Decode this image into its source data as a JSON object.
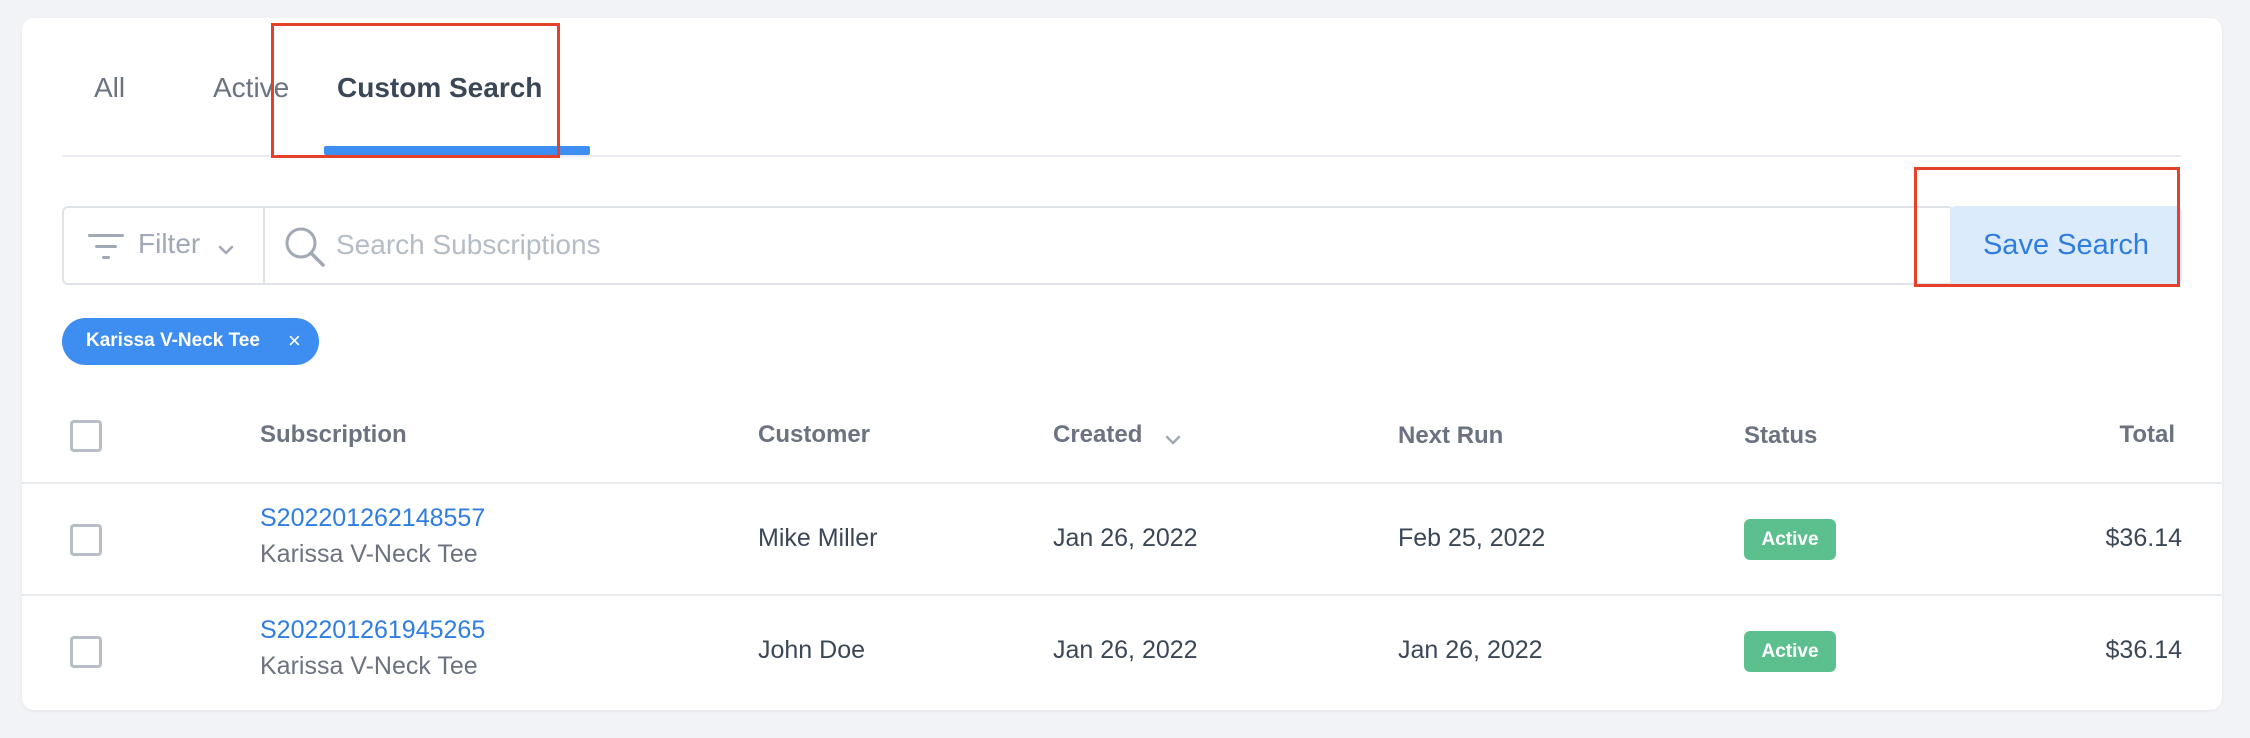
{
  "tabs": [
    {
      "label": "All"
    },
    {
      "label": "Active"
    },
    {
      "label": "Custom Search"
    }
  ],
  "toolbar": {
    "filter_label": "Filter",
    "search_placeholder": "Search Subscriptions",
    "save_label": "Save Search"
  },
  "chip": {
    "label": "Karissa V-Neck Tee",
    "close": "×"
  },
  "table": {
    "headers": {
      "subscription": "Subscription",
      "customer": "Customer",
      "created": "Created",
      "next_run": "Next Run",
      "status": "Status",
      "total": "Total"
    },
    "rows": [
      {
        "id": "S202201262148557",
        "product": "Karissa V-Neck Tee",
        "customer": "Mike Miller",
        "created": "Jan 26, 2022",
        "next_run": "Feb 25, 2022",
        "status": "Active",
        "total": "$36.14"
      },
      {
        "id": "S202201261945265",
        "product": "Karissa V-Neck Tee",
        "customer": "John Doe",
        "created": "Jan 26, 2022",
        "next_run": "Jan 26, 2022",
        "status": "Active",
        "total": "$36.14"
      }
    ]
  },
  "colors": {
    "accent": "#3d8ef0",
    "status_active": "#5cc08e",
    "highlight": "#e5412a"
  },
  "icons": [
    "filter-icon",
    "chevron-down-icon",
    "search-icon",
    "close-icon",
    "sort-desc-icon"
  ]
}
